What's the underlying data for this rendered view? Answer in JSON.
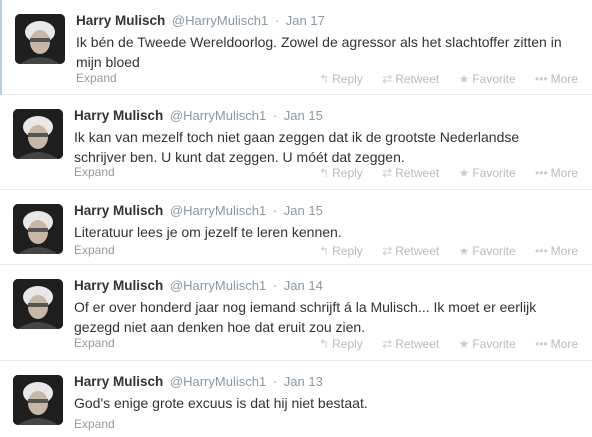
{
  "tweets": [
    {
      "name": "Harry Mulisch",
      "handle": "@HarryMulisch1",
      "date": "Jan 17",
      "text": "Ik bén de Tweede Wereldoorlog. Zowel de agressor als het slachtoffer zitten in mijn bloed",
      "expand": "Expand"
    },
    {
      "name": "Harry Mulisch",
      "handle": "@HarryMulisch1",
      "date": "Jan 15",
      "text": "Ik kan van mezelf toch niet gaan zeggen dat ik de grootste Nederlandse schrijver ben. U kunt dat zeggen. U móét dat zeggen.",
      "expand": "Expand"
    },
    {
      "name": "Harry Mulisch",
      "handle": "@HarryMulisch1",
      "date": "Jan 15",
      "text": "Literatuur lees je om jezelf te leren kennen.",
      "expand": "Expand"
    },
    {
      "name": "Harry Mulisch",
      "handle": "@HarryMulisch1",
      "date": "Jan 14",
      "text": "Of er over honderd jaar nog iemand schrijft á la Mulisch... Ik moet er eerlijk gezegd niet aan denken hoe dat eruit zou zien.",
      "expand": "Expand"
    },
    {
      "name": "Harry Mulisch",
      "handle": "@HarryMulisch1",
      "date": "Jan 13",
      "text": "God's enige grote excuus is dat hij niet bestaat.",
      "expand": "Expand"
    }
  ],
  "actions": {
    "reply": "Reply",
    "retweet": "Retweet",
    "favorite": "Favorite",
    "more": "More"
  },
  "separator": "·",
  "icons": {
    "reply": "reply-icon",
    "retweet": "retweet-icon",
    "favorite": "star-icon",
    "more": "more-dots-icon"
  },
  "colors": {
    "name": "#333333",
    "meta": "#8899a6",
    "action": "#bbbbbb",
    "divider": "#e8e8e8"
  }
}
